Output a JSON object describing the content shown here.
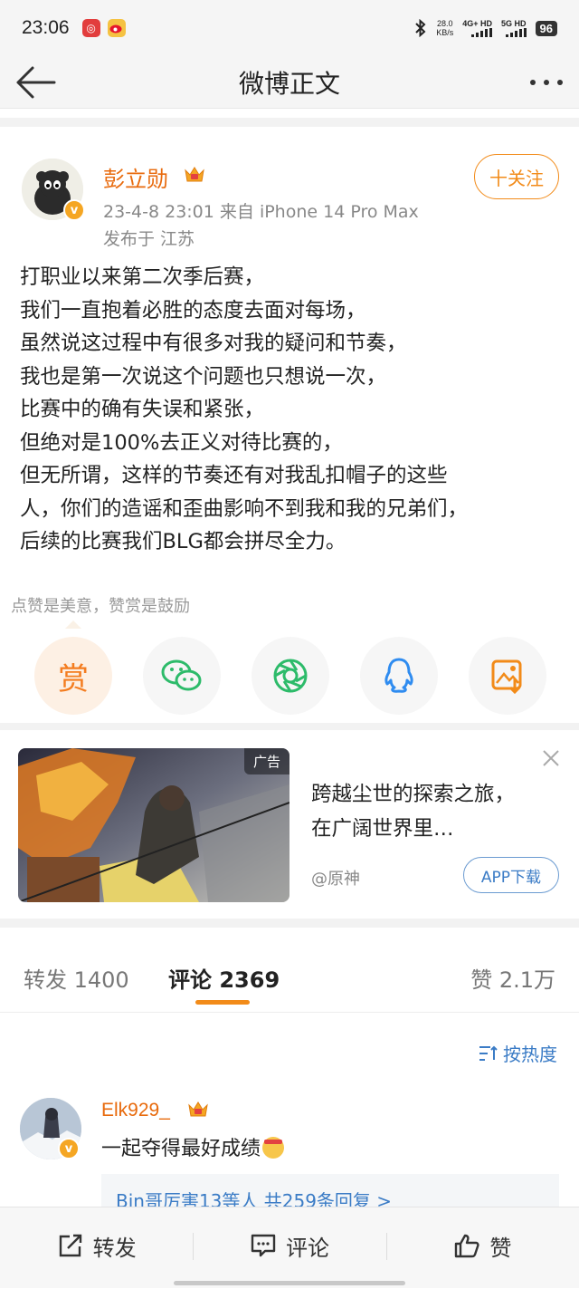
{
  "status_bar": {
    "time": "23:06",
    "net_speed_value": "28.0",
    "net_speed_unit": "KB/s",
    "signal1": "4G+ HD",
    "signal2": "5G HD",
    "battery": "96"
  },
  "nav": {
    "title": "微博正文"
  },
  "post": {
    "author": "彭立勋",
    "meta": "23-4-8 23:01  来自 iPhone 14 Pro Max",
    "location": "发布于 江苏",
    "follow_label": "十关注",
    "body_lines": [
      "打职业以来第二次季后赛，",
      "我们一直抱着必胜的态度去面对每场，",
      "虽然说这过程中有很多对我的疑问和节奏，",
      "我也是第一次说这个问题也只想说一次，",
      "比赛中的确有失误和紧张，",
      "但绝对是100%去正义对待比赛的，",
      "但无所谓，这样的节奏还有对我乱扣帽子的这些",
      "人，你们的造谣和歪曲影响不到我和我的兄弟们，",
      "后续的比赛我们BLG都会拼尽全力。"
    ],
    "tip_label": "点赞是美意，赞赏是鼓励",
    "reward_char": "赏"
  },
  "ad": {
    "tag": "广告",
    "title": "跨越尘世的探索之旅，在广阔世界里…",
    "source": "@原神",
    "button": "APP下载"
  },
  "tabs": {
    "repost": "转发 1400",
    "comment": "评论 2369",
    "like": "赞 2.1万"
  },
  "sort_label": "按热度",
  "comment": {
    "name": "Elk929_",
    "text": "一起夺得最好成绩",
    "replies": "Bin哥厉害13等人  共259条回复 >"
  },
  "bottom_bar": {
    "repost": "转发",
    "comment": "评论",
    "like": "赞"
  },
  "colors": {
    "accent": "#f28b19",
    "name": "#e86a0c",
    "link": "#3b7cc6"
  }
}
